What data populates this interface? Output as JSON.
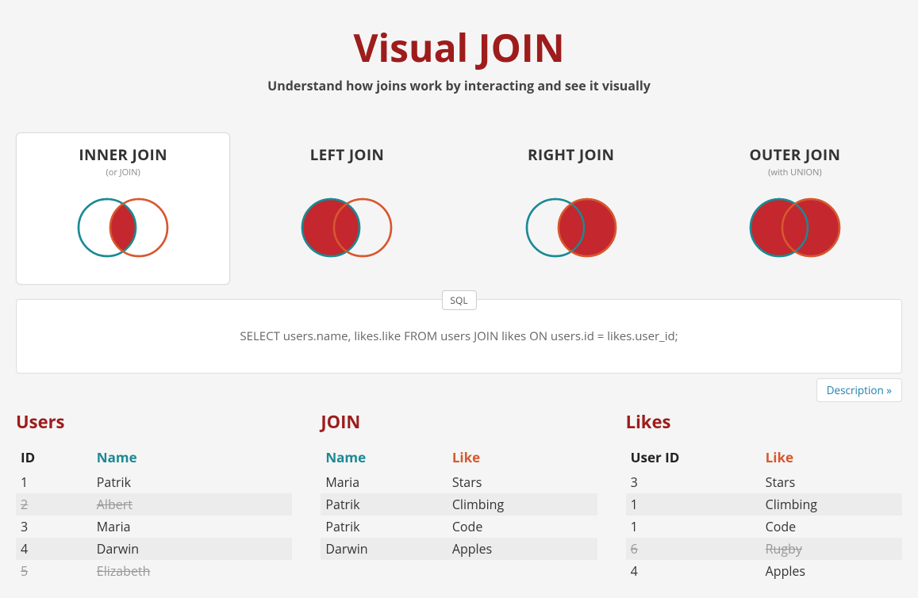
{
  "header": {
    "title": "Visual JOIN",
    "subtitle": "Understand how joins work by interacting and see it visually"
  },
  "cards": [
    {
      "title": "INNER JOIN",
      "sub": "(or JOIN)",
      "active": true,
      "left": "outline",
      "right": "outline",
      "inter": "fill"
    },
    {
      "title": "LEFT JOIN",
      "sub": "",
      "active": false,
      "left": "fill",
      "right": "outline",
      "inter": "fill"
    },
    {
      "title": "RIGHT JOIN",
      "sub": "",
      "active": false,
      "left": "outline",
      "right": "fill",
      "inter": "fill"
    },
    {
      "title": "OUTER JOIN",
      "sub": "(with UNION)",
      "active": false,
      "left": "fill",
      "right": "fill",
      "inter": "fill"
    }
  ],
  "sql": {
    "label": "SQL",
    "text": "SELECT users.name, likes.like FROM users JOIN likes ON users.id = likes.user_id;"
  },
  "description_link": "Description »",
  "tables": {
    "users": {
      "title": "Users",
      "headers": [
        {
          "label": "ID",
          "cls": "dark"
        },
        {
          "label": "Name",
          "cls": "teal"
        }
      ],
      "rows": [
        {
          "cells": [
            "1",
            "Patrik"
          ],
          "strike": false
        },
        {
          "cells": [
            "2",
            "Albert"
          ],
          "strike": true
        },
        {
          "cells": [
            "3",
            "Maria"
          ],
          "strike": false
        },
        {
          "cells": [
            "4",
            "Darwin"
          ],
          "strike": false
        },
        {
          "cells": [
            "5",
            "Elizabeth"
          ],
          "strike": true
        }
      ]
    },
    "join": {
      "title": "JOIN",
      "headers": [
        {
          "label": "Name",
          "cls": "teal"
        },
        {
          "label": "Like",
          "cls": "orange"
        }
      ],
      "rows": [
        {
          "cells": [
            "Maria",
            "Stars"
          ],
          "strike": false
        },
        {
          "cells": [
            "Patrik",
            "Climbing"
          ],
          "strike": false
        },
        {
          "cells": [
            "Patrik",
            "Code"
          ],
          "strike": false
        },
        {
          "cells": [
            "Darwin",
            "Apples"
          ],
          "strike": false
        }
      ]
    },
    "likes": {
      "title": "Likes",
      "headers": [
        {
          "label": "User ID",
          "cls": "dark"
        },
        {
          "label": "Like",
          "cls": "orange"
        }
      ],
      "rows": [
        {
          "cells": [
            "3",
            "Stars"
          ],
          "strike": false
        },
        {
          "cells": [
            "1",
            "Climbing"
          ],
          "strike": false
        },
        {
          "cells": [
            "1",
            "Code"
          ],
          "strike": false
        },
        {
          "cells": [
            "6",
            "Rugby"
          ],
          "strike": true
        },
        {
          "cells": [
            "4",
            "Apples"
          ],
          "strike": false
        }
      ]
    }
  },
  "colors": {
    "teal": "#1a8a94",
    "orange": "#d7582f",
    "fill": "#c4272d"
  }
}
